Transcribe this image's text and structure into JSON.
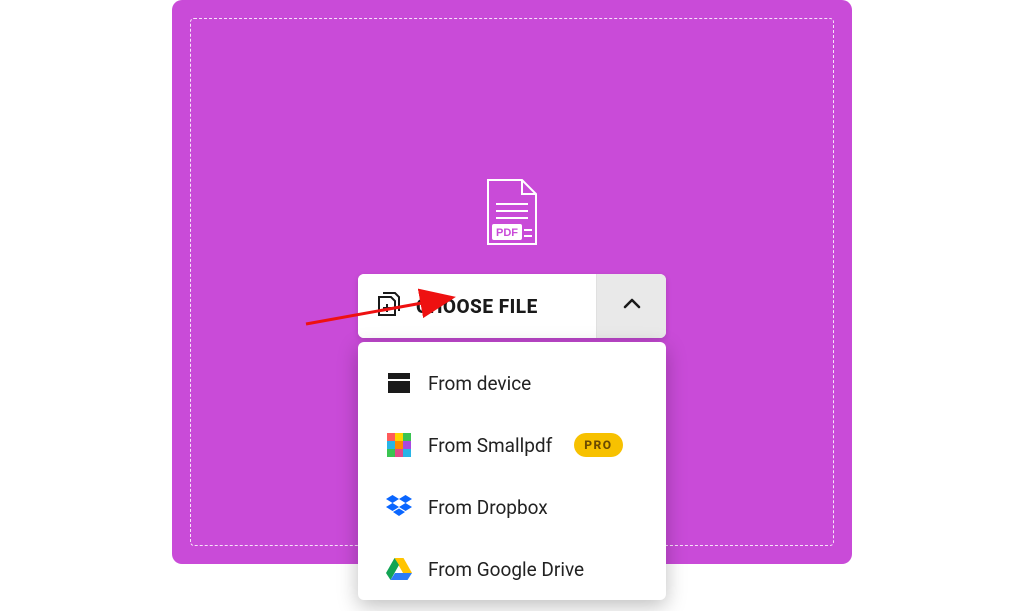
{
  "colors": {
    "panel": "#c94bd8",
    "badge_bg": "#f7c100",
    "badge_text": "#6b4b00"
  },
  "choose": {
    "label": "CHOOSE FILE"
  },
  "dropdown": {
    "items": [
      {
        "label": "From device",
        "icon": "folder-icon",
        "badge": null
      },
      {
        "label": "From Smallpdf",
        "icon": "smallpdf-logo-icon",
        "badge": "PRO"
      },
      {
        "label": "From Dropbox",
        "icon": "dropbox-icon",
        "badge": null
      },
      {
        "label": "From Google Drive",
        "icon": "google-drive-icon",
        "badge": null
      }
    ]
  },
  "icons": {
    "pdf_badge_text": "PDF"
  }
}
